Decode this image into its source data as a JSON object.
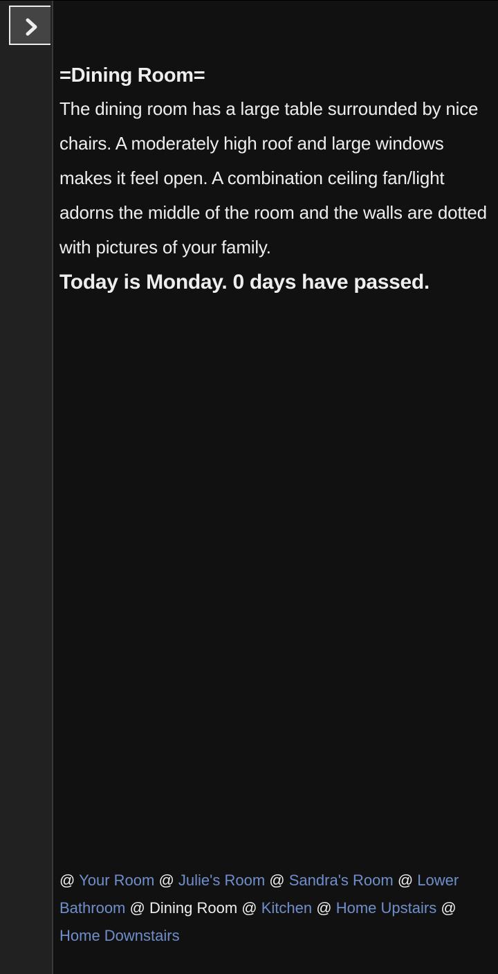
{
  "sidebar": {
    "toggle_icon": "chevron-right-icon"
  },
  "passage": {
    "title": "=Dining Room=",
    "description": "The dining room has a large table surrounded by nice chairs. A moderately high roof and large windows makes it feel open. A combination ceiling fan/light adorns the middle of the room and the walls are dotted with pictures of your family.",
    "status": "Today is Monday. 0 days have passed."
  },
  "nav": {
    "separator": "@",
    "items": [
      {
        "label": "Your Room",
        "link": true
      },
      {
        "label": "Julie's Room",
        "link": true
      },
      {
        "label": "Sandra's Room",
        "link": true
      },
      {
        "label": "Lower Bathroom",
        "link": true
      },
      {
        "label": "Dining Room",
        "link": false
      },
      {
        "label": "Kitchen",
        "link": true
      },
      {
        "label": "Home Upstairs",
        "link": true
      },
      {
        "label": "Home Downstairs",
        "link": true
      }
    ]
  },
  "colors": {
    "background": "#111111",
    "sidebar": "#212121",
    "text": "#eeeeee",
    "link": "#6f8fcc"
  }
}
